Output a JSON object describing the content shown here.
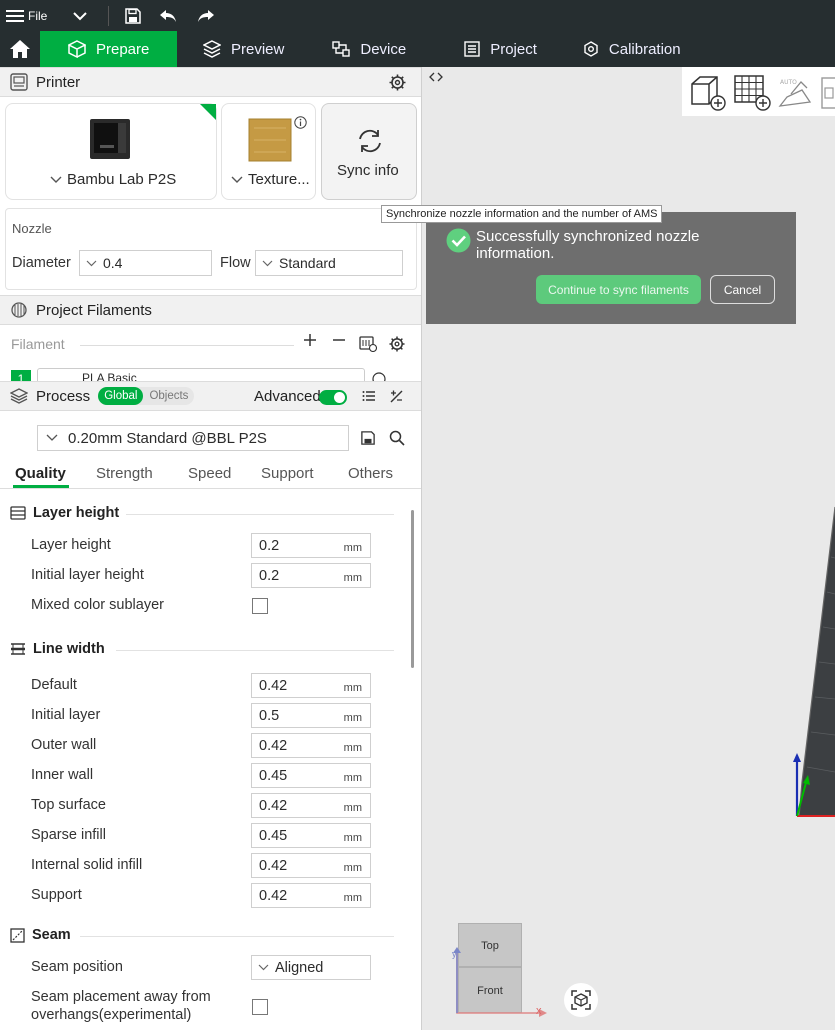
{
  "topbar": {
    "file_label": "File"
  },
  "nav": {
    "tabs": [
      {
        "label": "Prepare"
      },
      {
        "label": "Preview"
      },
      {
        "label": "Device"
      },
      {
        "label": "Project"
      },
      {
        "label": "Calibration"
      }
    ]
  },
  "printer": {
    "title": "Printer",
    "printer_name": "Bambu Lab P2S",
    "plate_name": "Texture...",
    "sync_label": "Sync info",
    "nozzle_label": "Nozzle",
    "diameter_label": "Diameter",
    "diameter_value": "0.4",
    "flow_label": "Flow",
    "flow_value": "Standard"
  },
  "filaments": {
    "title": "Project Filaments",
    "filament_label": "Filament",
    "slot_number": "1",
    "slot_name": "PLA Basic"
  },
  "process": {
    "title": "Process",
    "global_label": "Global",
    "objects_label": "Objects",
    "advanced_label": "Advanced",
    "preset": "0.20mm Standard @BBL P2S",
    "tabs": [
      "Quality",
      "Strength",
      "Speed",
      "Support",
      "Others"
    ]
  },
  "groups": {
    "layer_height": {
      "title": "Layer height",
      "rows": [
        {
          "label": "Layer height",
          "value": "0.2",
          "unit": "mm"
        },
        {
          "label": "Initial layer height",
          "value": "0.2",
          "unit": "mm"
        }
      ],
      "mixed_label": "Mixed color sublayer"
    },
    "line_width": {
      "title": "Line width",
      "rows": [
        {
          "label": "Default",
          "value": "0.42",
          "unit": "mm"
        },
        {
          "label": "Initial layer",
          "value": "0.5",
          "unit": "mm"
        },
        {
          "label": "Outer wall",
          "value": "0.42",
          "unit": "mm"
        },
        {
          "label": "Inner wall",
          "value": "0.45",
          "unit": "mm"
        },
        {
          "label": "Top surface",
          "value": "0.42",
          "unit": "mm"
        },
        {
          "label": "Sparse infill",
          "value": "0.45",
          "unit": "mm"
        },
        {
          "label": "Internal solid infill",
          "value": "0.42",
          "unit": "mm"
        },
        {
          "label": "Support",
          "value": "0.42",
          "unit": "mm"
        }
      ]
    },
    "seam": {
      "title": "Seam",
      "position_label": "Seam position",
      "position_value": "Aligned",
      "away_label_1": "Seam placement away from",
      "away_label_2": "overhangs(experimental)"
    }
  },
  "tooltip": "Synchronize nozzle information and the number of AMS",
  "toast": {
    "message_1": "Successfully synchronized nozzle",
    "message_2": "information.",
    "continue_label": "Continue to sync filaments",
    "cancel_label": "Cancel"
  },
  "viewport": {
    "cube_top": "Top",
    "cube_front": "Front",
    "axis_x": "x",
    "axis_y": "y",
    "auto_label": "AUTO"
  },
  "colors": {
    "accent": "#00ae42",
    "toolbar_bg": "#262e30",
    "toast_bg": "#6e6e6e"
  }
}
